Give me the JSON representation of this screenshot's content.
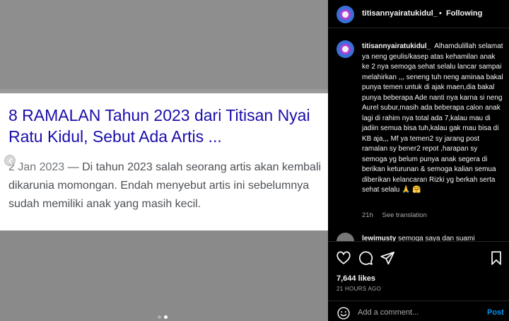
{
  "media": {
    "card": {
      "headline": "8 RAMALAN Tahun 2023 dari Titisan Nyai Ratu Kidul, Sebut Ada Artis ...",
      "date": "2 Jan 2023",
      "snippet": " — Di tahun 2023 salah seorang artis akan kembali dikarunia momongan. Endah menyebut artis ini sebelumnya sudah memiliki anak yang masih kecil."
    },
    "carousel": {
      "total": 2,
      "active_index": 1
    },
    "colors": {
      "link": "#1a0dab",
      "snippet": "#4d5156",
      "background": "#8c8c8c"
    }
  },
  "header": {
    "username": "titisannyairatukidul_",
    "separator": "•",
    "follow_status": "Following"
  },
  "comments": [
    {
      "username": "titisannyairatukidul_",
      "text": "Alhamdulillah selamat ya neng geulis/kasep atas kehamilan anak ke 2 nya semoga sehat selalu lancar sampai melahirkan ,,, seneng tuh neng aminaa bakal punya temen untuk di ajak maen,dia bakal punya beberapa Ade nanti nya karna si neng Aurel subur,masih ada beberapa calon anak lagi di rahim nya total ada 7,kalau mau di jadiin semua bisa tuh,kalau gak mau bisa di KB aja,,, Mf ya temen2 sy jarang post ramalan sy bener2 repot ,harapan sy semoga yg belum punya anak segera di berikan keturunan & semoga kalian semua diberikan kelancaran Rizki yg berkah serta sehat selalu 🙏 🤗",
      "age": "21h",
      "translation_label": "See translation"
    },
    {
      "username": "lewimusty",
      "text": "semoga saya dan suami"
    }
  ],
  "actions": {
    "icons": [
      "heart-icon",
      "comment-icon",
      "share-icon",
      "bookmark-icon"
    ],
    "likes": "7,644 likes",
    "timestamp": "21 HOURS AGO"
  },
  "add_comment": {
    "placeholder": "Add a comment...",
    "post_label": "Post"
  }
}
